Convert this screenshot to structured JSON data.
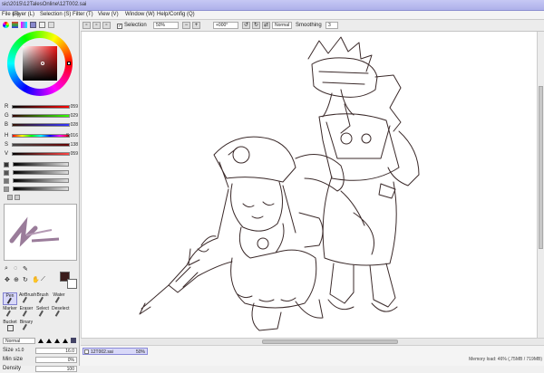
{
  "window": {
    "title": "sic\\2015\\12TalesOnline\\12T002.sai"
  },
  "menu": [
    {
      "label": "File (F)"
    },
    {
      "label": "Layer (L)"
    },
    {
      "label": "Selection (S)"
    },
    {
      "label": "Filter (T)"
    },
    {
      "label": "View (V)"
    },
    {
      "label": "Window (W)"
    },
    {
      "label": "Help/Config (Q)"
    }
  ],
  "toolbar": {
    "selection_label": "Selection",
    "zoom": "50%",
    "rotation": "+000°",
    "blend_mode": "Normal",
    "smoothing_label": "Smoothing",
    "smoothing_value": "3"
  },
  "color_panel": {
    "r_label": "R",
    "r_value": "059",
    "g_label": "G",
    "g_value": "029",
    "b_label": "B",
    "b_value": "028",
    "h_label": "H",
    "h_value": "S:016",
    "s_label": "S",
    "s_value": "138",
    "v_label": "V",
    "v_value": "059",
    "primary_color": "#3b1d1c"
  },
  "tools": {
    "items": [
      {
        "label": "Pen"
      },
      {
        "label": "AirBrush"
      },
      {
        "label": "Brush"
      },
      {
        "label": "Water"
      },
      {
        "label": "Marker"
      },
      {
        "label": "Eraser"
      },
      {
        "label": "Select"
      },
      {
        "label": "Deselect"
      },
      {
        "label": "Bucket"
      },
      {
        "label": "Binary"
      }
    ]
  },
  "brush_props": {
    "mode": "Normal",
    "size_label": "Size",
    "size_multiplier": "x1.0",
    "size_value": "16.0",
    "min_size_label": "Min size",
    "min_size_value": "0%",
    "density_label": "Density",
    "density_value": "100"
  },
  "documents": [
    {
      "name": "12T002.sai",
      "zoom": "50%"
    }
  ],
  "status": {
    "memory": "Memory load: 46% (,75MB / 719MB)"
  }
}
